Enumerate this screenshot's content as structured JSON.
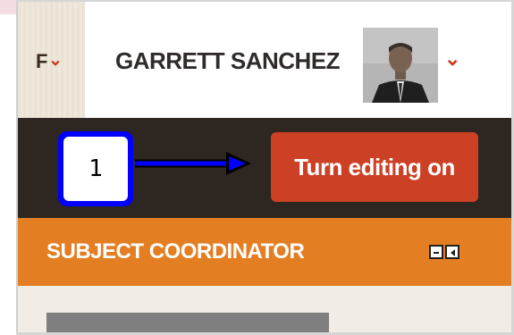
{
  "header": {
    "partial_label": "F",
    "user_name": "GARRETT SANCHEZ"
  },
  "toolbar": {
    "edit_button_label": "Turn editing on"
  },
  "annotation": {
    "callout_number": "1"
  },
  "block": {
    "title": "SUBJECT COORDINATOR"
  },
  "icons": {
    "menu_chevron": "chevron-down-icon",
    "user_caret": "chevron-down-icon",
    "minimize": "minimize-icon",
    "dock": "dock-icon"
  },
  "colors": {
    "accent_red": "#cc4026",
    "orange": "#e47e22",
    "dark_bar": "#2e2620",
    "callout_blue": "#0000ff"
  }
}
